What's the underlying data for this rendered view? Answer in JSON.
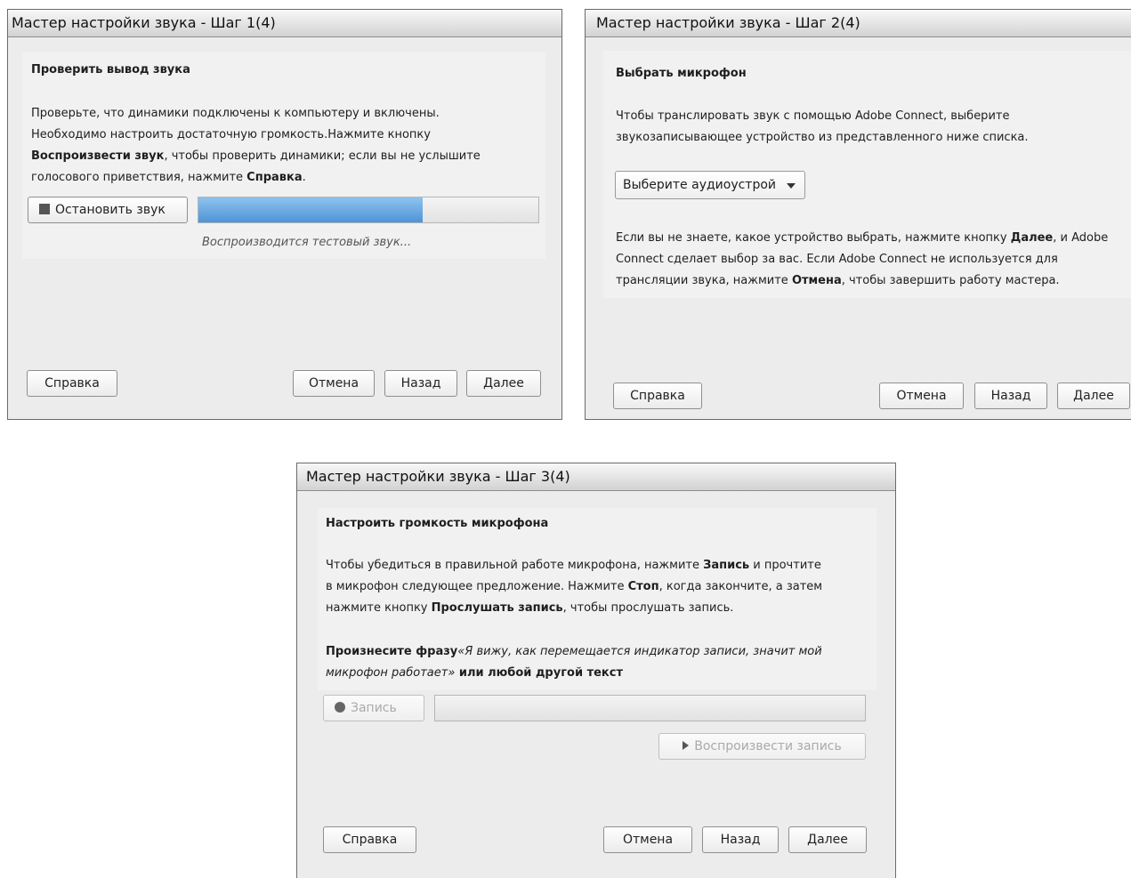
{
  "step1": {
    "title": "Мастер настройки звука - Шаг 1(4)",
    "heading": "Проверить вывод звука",
    "p1": "Проверьте, что динамики подключены к компьютеру и включены.",
    "p2": "Необходимо настроить достаточную громкость.Нажмите кнопку",
    "p3_bold": "Воспроизвести звук",
    "p3_rest": ", чтобы проверить динамики; если вы не услышите",
    "p4_pre": "голосового приветствия, нажмите ",
    "p4_bold": "Справка",
    "p4_end": ".",
    "stop_label": "Остановить звук",
    "progress": 0.66,
    "status": "Воспроизводится тестовый звук...",
    "help": "Справка",
    "cancel": "Отмена",
    "back": "Назад",
    "next": "Далее"
  },
  "step2": {
    "title": "Мастер настройки звука - Шаг 2(4)",
    "heading": "Выбрать микрофон",
    "p1": "Чтобы транслировать звук с помощью Adobe Connect, выберите",
    "p2": "звукозаписывающее устройство из представленного ниже списка.",
    "select": "Выберите аудиоустрой",
    "q1_pre": "Если вы не знаете, какое устройство выбрать, нажмите кнопку ",
    "q1_bold": "Далее",
    "q1_end": ", и Adobe",
    "q2": "Connect сделает выбор за вас. Если Adobe Connect не используется для",
    "q3_pre": "трансляции звука, нажмите ",
    "q3_bold": "Отмена",
    "q3_end": ", чтобы завершить работу мастера.",
    "help": "Справка",
    "cancel": "Отмена",
    "back": "Назад",
    "next": "Далее"
  },
  "step3": {
    "title": "Мастер настройки звука - Шаг 3(4)",
    "heading": "Настроить громкость микрофона",
    "a1_pre": "Чтобы убедиться в правильной работе микрофона, нажмите ",
    "a1_bold": "Запись",
    "a1_end": " и прочтите",
    "a2_pre": "в микрофон следующее предложение. Нажмите ",
    "a2_bold": "Стоп",
    "a2_end": ", когда закончите, а затем",
    "a3_pre": "нажмите кнопку ",
    "a3_bold": "Прослушать запись",
    "a3_end": ", чтобы прослушать запись.",
    "b1_bold": "Произнесите фразу",
    "b1_italic": "«Я вижу, как перемещается индикатор записи, значит мой",
    "b2_italic": "микрофон работает»",
    "b2_bold": " или любой другой текст",
    "record": "Запись",
    "play": "Воспроизвести запись",
    "help": "Справка",
    "cancel": "Отмена",
    "back": "Назад",
    "next": "Далее"
  },
  "colors": {
    "progress_fill": "#4e94d6",
    "dialog_bg": "#ececec",
    "panel_bg": "#f1f1f1"
  },
  "icons": [
    "stop-icon",
    "dropdown-arrow-icon",
    "record-icon",
    "play-icon"
  ]
}
